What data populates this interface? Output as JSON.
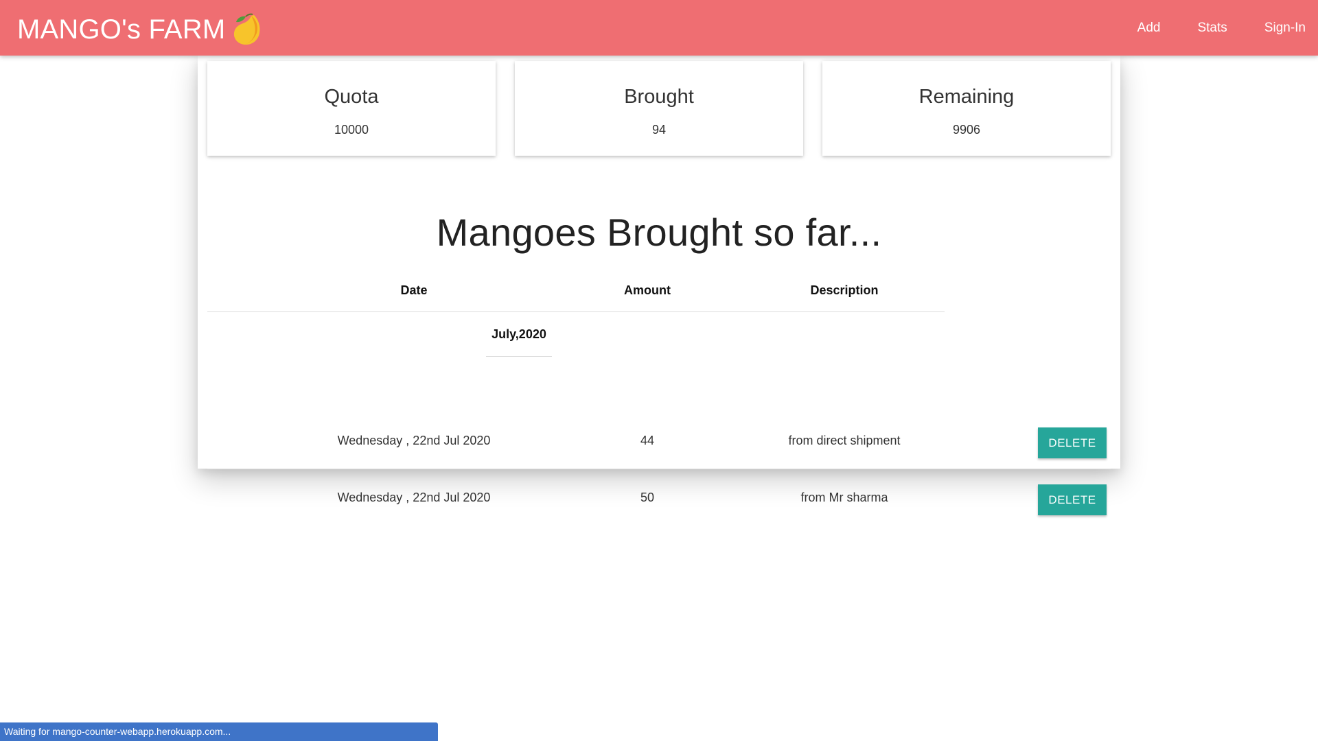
{
  "navbar": {
    "brand": "MANGO's FARM",
    "brand_icon": "mango-icon",
    "links": [
      {
        "label": "Add"
      },
      {
        "label": "Stats"
      },
      {
        "label": "Sign-In"
      }
    ],
    "background_color": "#ef6e72"
  },
  "stats": {
    "quota": {
      "label": "Quota",
      "value": "10000"
    },
    "brought": {
      "label": "Brought",
      "value": "94"
    },
    "remaining": {
      "label": "Remaining",
      "value": "9906"
    }
  },
  "heading": "Mangoes Brought so far...",
  "table": {
    "columns": [
      "Date",
      "Amount",
      "Description"
    ],
    "group": "July,2020",
    "rows": [
      {
        "date": "Wednesday , 22nd Jul 2020",
        "amount": "44",
        "description": "from direct shipment",
        "action": "DELETE"
      },
      {
        "date": "Wednesday , 22nd Jul 2020",
        "amount": "50",
        "description": "from Mr sharma",
        "action": "DELETE"
      }
    ],
    "button_color": "#26a69a"
  },
  "status_bar": {
    "text": "Waiting for mango-counter-webapp.herokuapp.com..."
  }
}
